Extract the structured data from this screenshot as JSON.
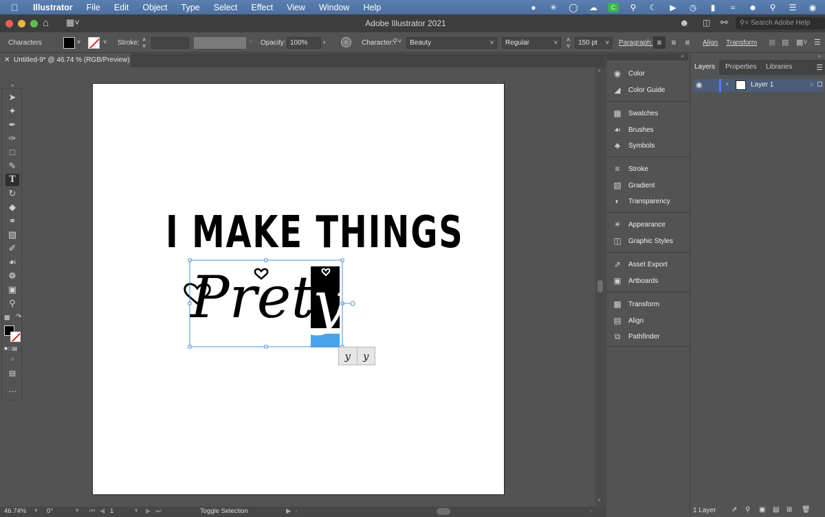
{
  "menubar": {
    "app": "Illustrator",
    "items": [
      "File",
      "Edit",
      "Object",
      "Type",
      "Select",
      "Effect",
      "View",
      "Window",
      "Help"
    ]
  },
  "titlebar": {
    "title": "Adobe Illustrator 2021",
    "search_placeholder": "Search Adobe Help"
  },
  "controlbar": {
    "panel_name": "Characters",
    "stroke_label": "Stroke:",
    "opacity_label": "Opacity:",
    "opacity_value": "100%",
    "character_label": "Character:",
    "font_family": "Beauty",
    "font_style": "Regular",
    "font_size": "150 pt",
    "paragraph_label": "Paragraph:",
    "align_label": "Align",
    "transform_label": "Transform"
  },
  "document": {
    "tab_title": "Untitled-9* @ 46.74 % (RGB/Preview)"
  },
  "artwork": {
    "headline": "I MAKE THINGS",
    "script_word": "Prett",
    "selected_glyph": "y",
    "alternates": [
      "y",
      "y"
    ]
  },
  "statusbar": {
    "zoom": "46.74%",
    "rotation": "0°",
    "artboard_number": "1",
    "tool_status": "Toggle Selection"
  },
  "dock": {
    "items": [
      "Color",
      "Color Guide",
      "Swatches",
      "Brushes",
      "Symbols",
      "Stroke",
      "Gradient",
      "Transparency",
      "Appearance",
      "Graphic Styles",
      "Asset Export",
      "Artboards",
      "Transform",
      "Align",
      "Pathfinder"
    ]
  },
  "layers_panel": {
    "tabs": [
      "Layers",
      "Properties",
      "Libraries"
    ],
    "layer_name": "Layer 1",
    "count_label": "1 Layer"
  },
  "colors": {
    "selection_blue": "#4a90e2",
    "glyph_highlight": "#4aa3e8",
    "layer_color": "#4f7dff"
  }
}
